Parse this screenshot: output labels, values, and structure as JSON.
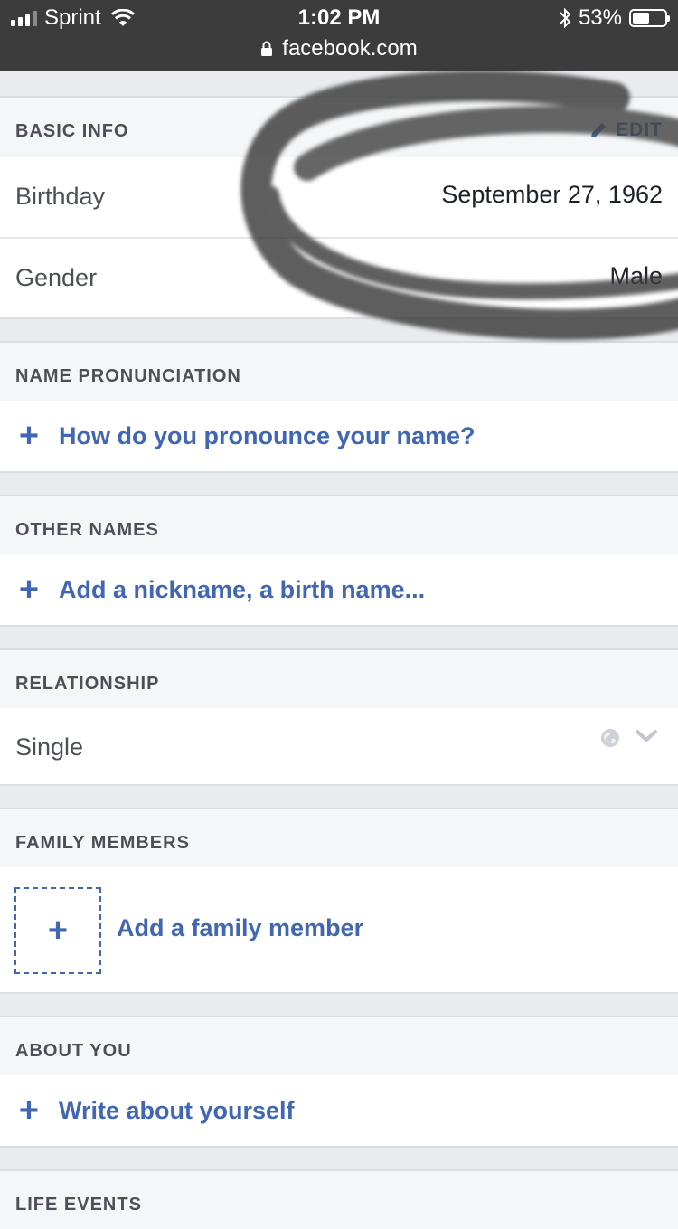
{
  "status_bar": {
    "carrier": "Sprint",
    "time": "1:02 PM",
    "battery_percent": "53%",
    "battery_level": 0.53,
    "url": "facebook.com"
  },
  "basic_info": {
    "title": "BASIC INFO",
    "edit_label": "EDIT",
    "rows": [
      {
        "label": "Birthday",
        "value": "September 27, 1962"
      },
      {
        "label": "Gender",
        "value": "Male"
      }
    ]
  },
  "name_pronunciation": {
    "title": "NAME PRONUNCIATION",
    "action": "How do you pronounce your name?"
  },
  "other_names": {
    "title": "OTHER NAMES",
    "action": "Add a nickname, a birth name..."
  },
  "relationship": {
    "title": "RELATIONSHIP",
    "status": "Single"
  },
  "family_members": {
    "title": "FAMILY MEMBERS",
    "action": "Add a family member"
  },
  "about_you": {
    "title": "ABOUT YOU",
    "action": "Write about yourself"
  },
  "life_events": {
    "title": "LIFE EVENTS"
  },
  "colors": {
    "link_blue": "#4267b2",
    "page_gray": "#e9ebee",
    "status_bar": "#3c3c3c"
  }
}
